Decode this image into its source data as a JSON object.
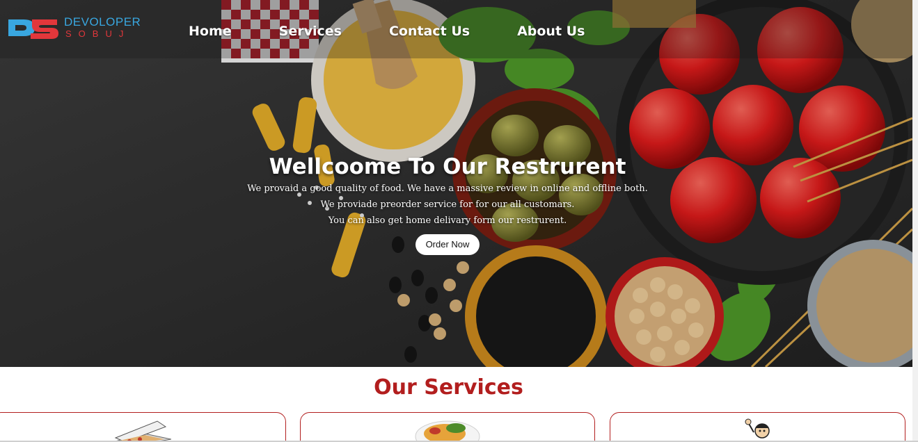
{
  "brand": {
    "line1": "DEVOLOPER",
    "line2": "SOBUJ",
    "colors": {
      "blue": "#39a7e0",
      "red": "#e2373b"
    }
  },
  "nav": {
    "items": [
      {
        "label": "Home"
      },
      {
        "label": "Services"
      },
      {
        "label": "Contact Us"
      },
      {
        "label": "About Us"
      }
    ]
  },
  "hero": {
    "title": "Wellcoome To Our Restrurent",
    "lines": [
      "We provaid a good quality of food. We have a massive review in online and offline both.",
      "We proviade preorder service for for our all customars.",
      "You can also get home delivary form our restrurent."
    ],
    "cta": "Order Now"
  },
  "services": {
    "title": "Our Services",
    "accent_color": "#b21e1e",
    "cards": [
      {
        "icon": "pizza-box-icon"
      },
      {
        "icon": "food-plate-icon"
      },
      {
        "icon": "delivery-person-icon"
      }
    ]
  }
}
